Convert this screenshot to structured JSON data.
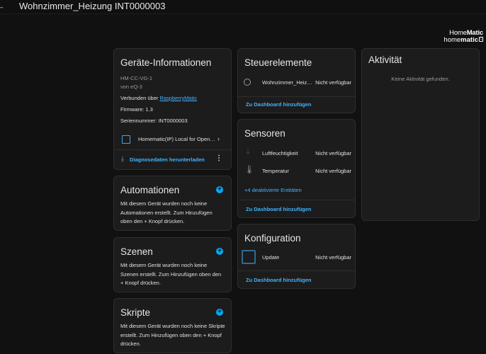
{
  "header": {
    "title": "Wohnzimmer_Heizung INT0000003",
    "back_icon": "arrow-left-icon"
  },
  "brand": {
    "line1_a": "Home",
    "line1_b": "Matic",
    "line2_a": "home",
    "line2_b": "matic"
  },
  "device_info": {
    "title": "Geräte-Informationen",
    "model": "HM-CC-VG-1",
    "manufacturer": "von eQ-3",
    "connected_prefix": "Verbunden über ",
    "connected_link": "RaspberryMatic",
    "firmware": "Firmware: 1.3",
    "serial": "Seriennummer: INT0000003",
    "integration": "Homematic(IP) Local for Open…",
    "download_label": "Diagnosedaten herunterladen"
  },
  "automations": {
    "title": "Automationen",
    "text": "Mit diesem Gerät wurden noch keine Automationen erstellt. Zum Hinzufügen oben den + Knopf drücken."
  },
  "scenes": {
    "title": "Szenen",
    "text": "Mit diesem Gerät wurden noch keine Szenen erstellt. Zum Hinzufügen oben den + Knopf drücken."
  },
  "scripts": {
    "title": "Skripte",
    "text": "Mit diesem Gerät wurden noch keine Skripte erstellt. Zum Hinzufügen oben den + Knopf drücken."
  },
  "controls": {
    "title": "Steuerelemente",
    "rows": [
      {
        "name": "Wohnzimmer_Heiz…",
        "state": "Nicht verfügbar",
        "icon": "thermostat-icon"
      }
    ],
    "add_label": "Zu Dashboard hinzufügen"
  },
  "sensors": {
    "title": "Sensoren",
    "rows": [
      {
        "name": "Luftfeuchtigkeit",
        "state": "Nicht verfügbar",
        "icon": "water-percent-icon"
      },
      {
        "name": "Temperatur",
        "state": "Nicht verfügbar",
        "icon": "thermometer-icon"
      }
    ],
    "disabled_label": "+4 deaktivierte Entitäten",
    "add_label": "Zu Dashboard hinzufügen"
  },
  "config": {
    "title": "Konfiguration",
    "rows": [
      {
        "name": "Update",
        "state": "Nicht verfügbar",
        "icon": "update-icon"
      }
    ],
    "add_label": "Zu Dashboard hinzufügen"
  },
  "activity": {
    "title": "Aktivität",
    "empty": "Keine Aktivität gefunden."
  }
}
